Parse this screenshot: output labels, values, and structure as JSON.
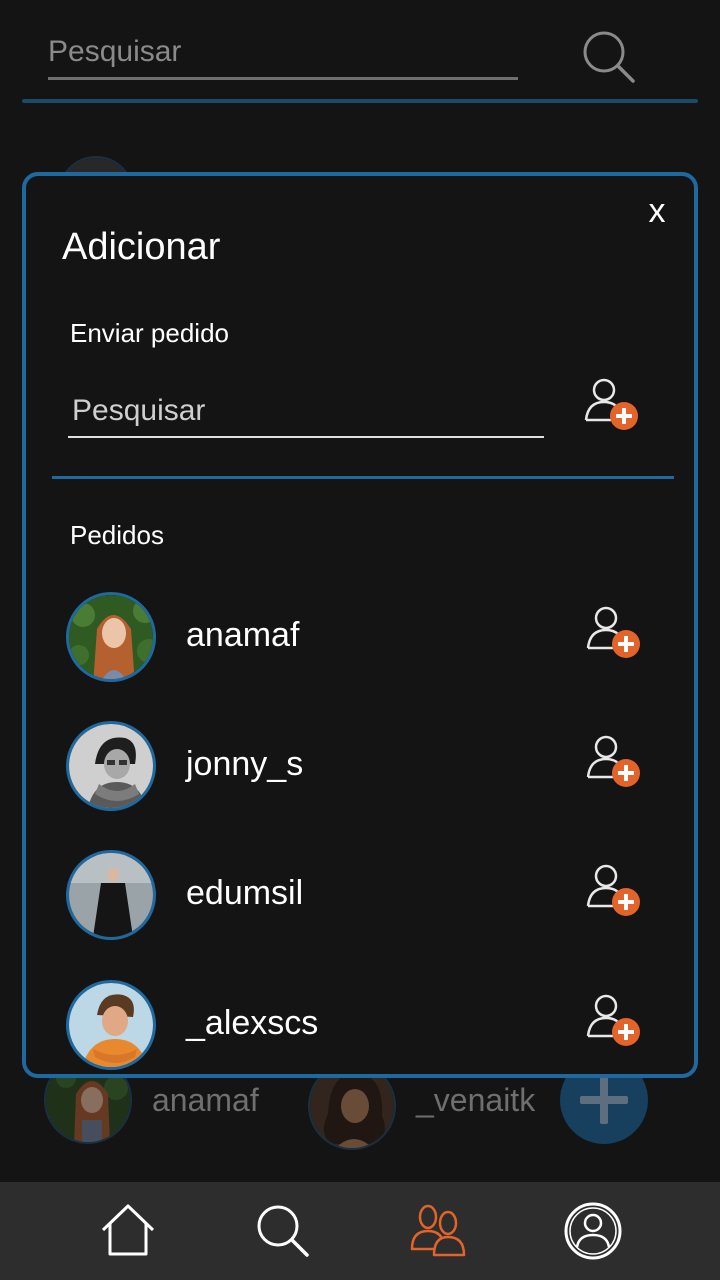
{
  "top_bar": {
    "search_placeholder": "Pesquisar"
  },
  "background": {
    "contacts": [
      {
        "name": "anamaf"
      },
      {
        "name": "_venaitk"
      }
    ]
  },
  "modal": {
    "close_label": "x",
    "title": "Adicionar",
    "send_request_label": "Enviar pedido",
    "search_placeholder": "Pesquisar",
    "requests_label": "Pedidos",
    "requests": [
      {
        "name": "anamaf"
      },
      {
        "name": "jonny_s"
      },
      {
        "name": "edumsil"
      },
      {
        "name": "_alexscs"
      }
    ]
  },
  "bottom_nav": {
    "items": [
      "home-icon",
      "search-icon",
      "friends-icon",
      "profile-icon"
    ],
    "active": "friends-icon"
  },
  "colors": {
    "accent": "#1e6aa0",
    "active_nav": "#e2642a",
    "add_badge": "#e2642a",
    "background": "#141414"
  }
}
